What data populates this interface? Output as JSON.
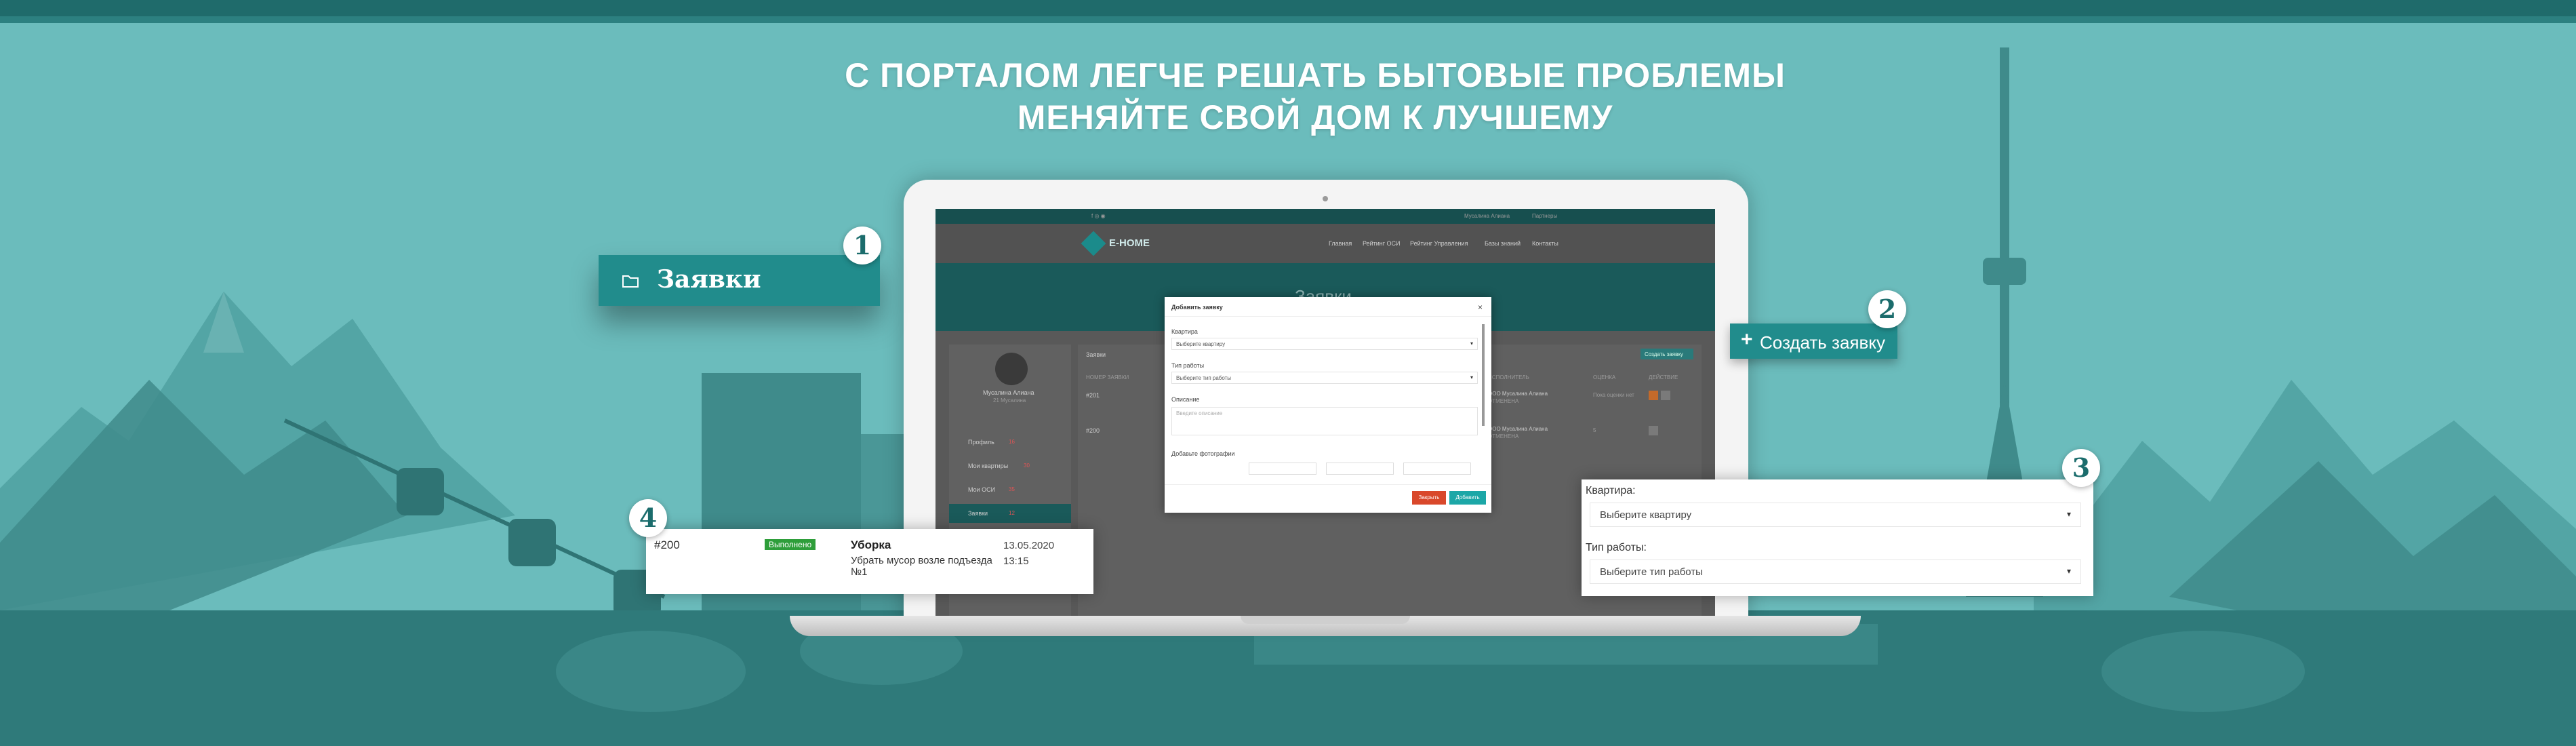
{
  "headline": {
    "line1": "С ПОРТАЛОМ ЛЕГЧЕ РЕШАТЬ БЫТОВЫЕ ПРОБЛЕМЫ",
    "line2": "МЕНЯЙТЕ СВОЙ  ДОМ К ЛУЧШЕМУ"
  },
  "colors": {
    "background": "#6bbcbc",
    "brand_teal": "#218c8c",
    "dark_teal": "#1b6c6c",
    "status_done": "#2e9e3a",
    "button_red": "#d9482b",
    "button_teal": "#1ca7a7"
  },
  "icons": {
    "folder": "folder-icon",
    "plus": "plus-icon",
    "chevron": "chevron-down-icon"
  },
  "callout1": {
    "number": "1",
    "label": "Заявки"
  },
  "callout2": {
    "number": "2",
    "button_label": "Создать заявку"
  },
  "callout3": {
    "number": "3",
    "apartment_label": "Квартира:",
    "apartment_placeholder": "Выберите квартиру",
    "work_type_label": "Тип работы:",
    "work_type_placeholder": "Выберите тип работы"
  },
  "callout4": {
    "number": "4",
    "id": "#200",
    "status": "Выполнено",
    "category": "Уборка",
    "description": "Убрать мусор возле подъезда №1",
    "date": "13.05.2020",
    "time": "13:15"
  },
  "screen": {
    "logo": "E-HOME",
    "topbar_user": "Мусалина Алиана",
    "topbar_link": "Партнеры",
    "nav": [
      "Главная",
      "Рейтинг ОСИ",
      "Рейтинг Управления",
      "Базы знаний",
      "Контакты"
    ],
    "banner_title": "Заявки",
    "profile_name": "Мусалина Алиана",
    "profile_sub": "21 Мусалина",
    "sidebar": [
      {
        "label": "Профиль",
        "count": "16"
      },
      {
        "label": "Мои квартиры",
        "count": "30"
      },
      {
        "label": "Мои ОСИ",
        "count": "35"
      },
      {
        "label": "Заявки",
        "count": "12"
      }
    ],
    "tab_label": "Заявки",
    "create_btn": "Создать заявку",
    "columns": [
      "НОМЕР ЗАЯВКИ",
      "ИСПОЛНИТЕЛЬ",
      "ОЦЕНКА",
      "ДЕЙСТВИЕ"
    ],
    "rows": [
      {
        "num": "#201",
        "executor": "ООО Мусалина Алиана",
        "executor_sub": "ОТМЕНЕНА",
        "rating": "Пока оценки нет"
      },
      {
        "num": "#200",
        "executor": "ООО Мусалина Алиана",
        "executor_sub": "ОТМЕНЕНА",
        "rating": "5"
      }
    ]
  },
  "modal": {
    "title": "Добавить заявку",
    "close": "×",
    "apartment_label": "Квартира",
    "apartment_placeholder": "Выберите квартиру",
    "work_type_label": "Тип работы",
    "work_type_placeholder": "Выберите тип работы",
    "description_label": "Описание",
    "description_placeholder": "Введите описание",
    "photos_label": "Добавьте фотографии",
    "close_btn": "Закрыть",
    "add_btn": "Добавить"
  }
}
